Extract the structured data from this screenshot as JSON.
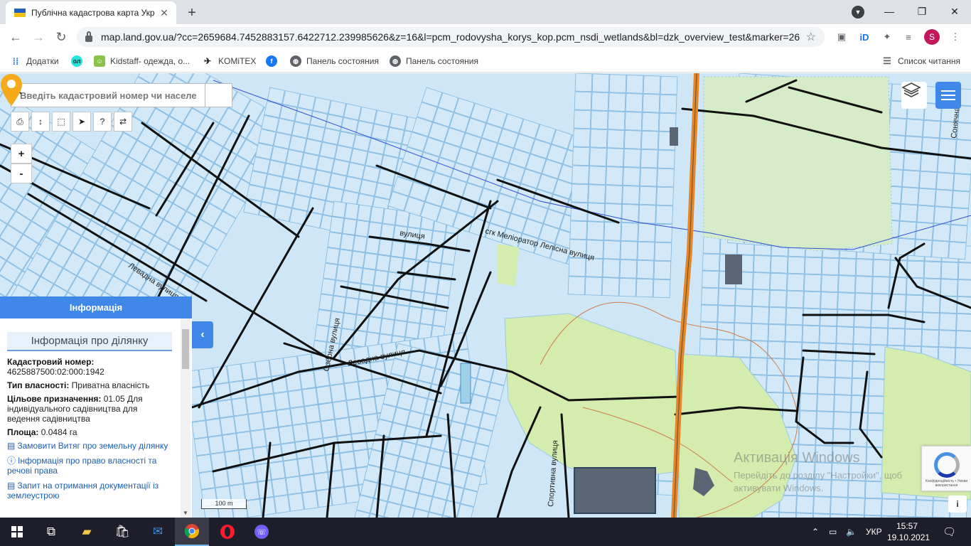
{
  "browser": {
    "tab_title": "Публічна кадастрова карта Укр",
    "tab_close": "✕",
    "new_tab": "+",
    "url": "map.land.gov.ua/?cc=2659684.7452883157.6422712.239985626&z=16&l=pcm_rodovysha_korys_kop.pcm_nsdi_wetlands&bl=dzk_overview_test&marker=26...",
    "profile_initial": "S"
  },
  "bookmarks": [
    {
      "label": "Додатки",
      "icon": "apps-icon"
    },
    {
      "label": "",
      "icon": "olx-icon"
    },
    {
      "label": "Kidstaff- одежда, о...",
      "icon": "kidstaff-icon"
    },
    {
      "label": "KOMiTEX",
      "icon": "komitex-icon"
    },
    {
      "label": "",
      "icon": "facebook-icon"
    },
    {
      "label": "Панель состояния",
      "icon": "globe-icon"
    },
    {
      "label": "Панель состояния",
      "icon": "globe-icon"
    }
  ],
  "reading_list": "Список читання",
  "map": {
    "search_placeholder": "Введіть кадастровий номер чи населений",
    "zoom_in": "+",
    "zoom_out": "-",
    "scale_label": "100 m",
    "panel_toggle": "‹",
    "info_button": "i",
    "street_labels": {
      "levadna_1": "Левадна вулиця",
      "levadna_2": "Левадна вулиця",
      "ozerna": "Озерна вулиця",
      "vulytsia": "вулиця",
      "meliorator": "сгк Меліоратор Лелісна вулиця",
      "sportyvna": "Спортивна вулиця",
      "sonyachna": "Сонячна в"
    },
    "accent_color": "#3f87e8",
    "pin_color": "#f6a91b"
  },
  "info_panel": {
    "header": "Інформація",
    "subheader": "Інформація про ділянку",
    "cadastral_label": "Кадастровий номер:",
    "cadastral_value": "4625887500:02:000:1942",
    "ownership_label": "Тип власності:",
    "ownership_value": "Приватна власність",
    "purpose_label": "Цільове призначення:",
    "purpose_value": "01.05 Для індивідуального садівництва для ведення садівництва",
    "area_label": "Площа:",
    "area_value": "0.0484 га",
    "links": [
      "Замовити Витяг про земельну ділянку",
      "Інформація про право власності та речові права",
      "Запит на отримання документації із землеустрою"
    ]
  },
  "watermark": {
    "title": "Активація Windows",
    "subtitle": "Перейдіть до розділу \"Настройки\", щоб активувати Windows."
  },
  "recaptcha_text": "Конфіденційність • Умови використання",
  "taskbar": {
    "language": "УКР",
    "time": "15:57",
    "date": "19.10.2021"
  }
}
